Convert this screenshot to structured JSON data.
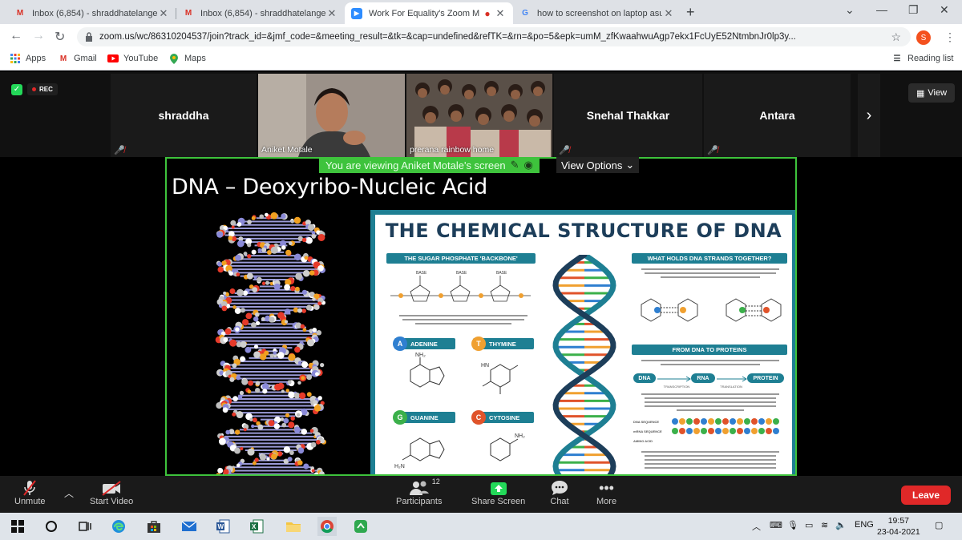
{
  "browser": {
    "tabs": [
      {
        "label": "Inbox (6,854) - shraddhatelange5",
        "icon": "gmail-icon"
      },
      {
        "label": "Inbox (6,854) - shraddhatelange5",
        "icon": "gmail-icon"
      },
      {
        "label": "Work For Equality's Zoom M",
        "icon": "zoom-icon",
        "active": true
      },
      {
        "label": "how to screenshot on laptop asu",
        "icon": "google-icon"
      }
    ],
    "url": "zoom.us/wc/86310204537/join?track_id=&jmf_code=&meeting_result=&tk=&cap=undefined&refTK=&rn=&po=5&epk=umM_zfKwaahwuAgp7ekx1FcUyE52NtmbnJr0lp3y...",
    "profile_initial": "S",
    "bookmarks": [
      "Apps",
      "Gmail",
      "YouTube",
      "Maps"
    ],
    "reading_list": "Reading list"
  },
  "zoom": {
    "rec_label": "REC",
    "participants": [
      {
        "name": "shraddha",
        "type": "name"
      },
      {
        "name": "Aniket Motale",
        "type": "video"
      },
      {
        "name": "prerana rainbow home",
        "type": "video"
      },
      {
        "name": "Snehal Thakkar",
        "type": "name"
      },
      {
        "name": "Antara",
        "type": "name"
      }
    ],
    "view_label": "View",
    "viewing_banner": "You are viewing Aniket Motale's screen",
    "view_options": "View Options",
    "controls": {
      "unmute": "Unmute",
      "start_video": "Start Video",
      "participants": "Participants",
      "participants_count": "12",
      "share_screen": "Share Screen",
      "chat": "Chat",
      "more": "More",
      "leave": "Leave"
    }
  },
  "slide": {
    "title": "DNA – Deoxyribo-Nucleic Acid",
    "poster": {
      "heading": "THE CHEMICAL STRUCTURE OF DNA",
      "backbone": "THE SUGAR PHOSPHATE 'BACKBONE'",
      "base_word": "BASE",
      "what_holds": "WHAT HOLDS DNA STRANDS TOGETHER?",
      "dna_to_proteins": "FROM DNA TO PROTEINS",
      "bases": [
        {
          "letter": "A",
          "name": "ADENINE",
          "color": "#2f7fd0"
        },
        {
          "letter": "T",
          "name": "THYMINE",
          "color": "#f0a030"
        },
        {
          "letter": "G",
          "name": "GUANINE",
          "color": "#3bb04a"
        },
        {
          "letter": "C",
          "name": "CYTOSINE",
          "color": "#e0532a"
        }
      ],
      "flow": {
        "dna": "DNA",
        "rna": "RNA",
        "protein": "PROTEIN",
        "transcription": "TRANSCRIPTION",
        "translation": "TRANSLATION"
      },
      "seq_labels": {
        "dna": "DNA SEQUENCE",
        "mrna": "mRNA SEQUENCE",
        "amino": "AMINO ACID"
      }
    }
  },
  "taskbar": {
    "lang": "ENG",
    "time": "19:57",
    "date": "23-04-2021"
  }
}
